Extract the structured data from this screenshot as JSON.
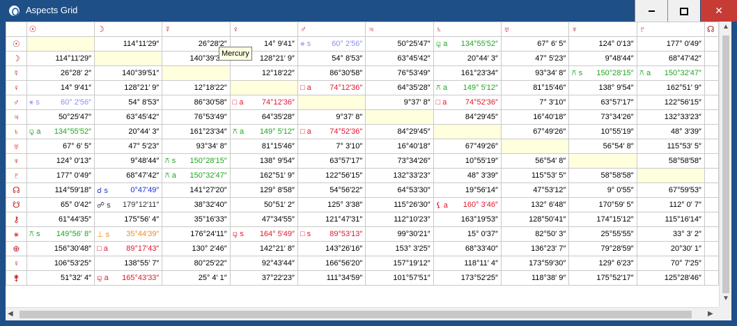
{
  "window": {
    "title": "Aspects Grid",
    "controls": {
      "minimize": "minimize",
      "maximize": "maximize",
      "close": "close",
      "close_glyph": "✕"
    }
  },
  "tooltip": "Mercury",
  "columns": [
    "☉",
    "☽",
    "☿",
    "♀",
    "♂",
    "♃",
    "♄",
    "♅",
    "♆",
    "♇",
    "☊"
  ],
  "rows": [
    {
      "glyph": "☉",
      "cells": [
        {
          "diag": true
        },
        {
          "v": "114°11′29″"
        },
        {
          "v": "26°28′2″"
        },
        {
          "v": "14° 9′41″"
        },
        {
          "a": "⚹ s",
          "c": "#8b8ef0",
          "v": "60° 2′56″"
        },
        {
          "v": "50°25′47″"
        },
        {
          "a": "⚼ a",
          "c": "#1ea51e",
          "v": "134°55′52″"
        },
        {
          "v": "67° 6′ 5″"
        },
        {
          "v": "124° 0′13″"
        },
        {
          "v": "177° 0′49″"
        },
        {
          "v": ""
        }
      ]
    },
    {
      "glyph": "☽",
      "cells": [
        {
          "v": "114°11′29″"
        },
        {
          "diag": true
        },
        {
          "v": "140°39′31″"
        },
        {
          "v": "128°21′ 9″"
        },
        {
          "v": "54° 8′53″"
        },
        {
          "v": "63°45′42″"
        },
        {
          "v": "20°44′ 3″"
        },
        {
          "v": "47° 5′23″"
        },
        {
          "v": "9°48′44″"
        },
        {
          "v": "68°47′42″"
        },
        {
          "v": ""
        }
      ]
    },
    {
      "glyph": "☿",
      "cells": [
        {
          "v": "26°28′ 2″"
        },
        {
          "v": "140°39′51″"
        },
        {
          "diag": true
        },
        {
          "v": "12°18′22″"
        },
        {
          "v": "86°30′58″"
        },
        {
          "v": "76°53′49″"
        },
        {
          "v": "161°23′34″"
        },
        {
          "v": "93°34′ 8″"
        },
        {
          "a": "⚻ s",
          "c": "#1ea51e",
          "v": "150°28′15″"
        },
        {
          "a": "⚻ a",
          "c": "#1ea51e",
          "v": "150°32′47″"
        },
        {
          "v": ""
        }
      ]
    },
    {
      "glyph": "♀",
      "cells": [
        {
          "v": "14° 9′41″"
        },
        {
          "v": "128°21′ 9″"
        },
        {
          "v": "12°18′22″"
        },
        {
          "diag": true
        },
        {
          "a": "□ a",
          "c": "#e0162b",
          "v": "74°12′36″"
        },
        {
          "v": "64°35′28″"
        },
        {
          "a": "⚻ a",
          "c": "#1ea51e",
          "v": "149° 5′12″"
        },
        {
          "v": "81°15′46″"
        },
        {
          "v": "138° 9′54″"
        },
        {
          "v": "162°51′ 9″"
        },
        {
          "v": ""
        }
      ]
    },
    {
      "glyph": "♂",
      "cells": [
        {
          "a": "⚹ s",
          "c": "#8b8ef0",
          "v": "60° 2′56″"
        },
        {
          "v": "54° 8′53″"
        },
        {
          "v": "86°30′58″"
        },
        {
          "a": "□ a",
          "c": "#e0162b",
          "v": "74°12′36″"
        },
        {
          "diag": true
        },
        {
          "v": "9°37′ 8″"
        },
        {
          "a": "□ a",
          "c": "#e0162b",
          "v": "74°52′36″"
        },
        {
          "v": "7° 3′10″"
        },
        {
          "v": "63°57′17″"
        },
        {
          "v": "122°56′15″"
        },
        {
          "v": ""
        }
      ]
    },
    {
      "glyph": "♃",
      "cells": [
        {
          "v": "50°25′47″"
        },
        {
          "v": "63°45′42″"
        },
        {
          "v": "76°53′49″"
        },
        {
          "v": "64°35′28″"
        },
        {
          "v": "9°37′ 8″"
        },
        {
          "diag": true
        },
        {
          "v": "84°29′45″"
        },
        {
          "v": "16°40′18″"
        },
        {
          "v": "73°34′26″"
        },
        {
          "v": "132°33′23″"
        },
        {
          "v": ""
        }
      ]
    },
    {
      "glyph": "♄",
      "cells": [
        {
          "a": "⚼ a",
          "c": "#1ea51e",
          "v": "134°55′52″"
        },
        {
          "v": "20°44′ 3″"
        },
        {
          "v": "161°23′34″"
        },
        {
          "a": "⚻ a",
          "c": "#1ea51e",
          "v": "149° 5′12″"
        },
        {
          "a": "□ a",
          "c": "#e0162b",
          "v": "74°52′36″"
        },
        {
          "v": "84°29′45″"
        },
        {
          "diag": true
        },
        {
          "v": "67°49′26″"
        },
        {
          "v": "10°55′19″"
        },
        {
          "v": "48° 3′39″"
        },
        {
          "v": ""
        }
      ]
    },
    {
      "glyph": "♅",
      "cells": [
        {
          "v": "67° 6′ 5″"
        },
        {
          "v": "47° 5′23″"
        },
        {
          "v": "93°34′ 8″"
        },
        {
          "v": "81°15′46″"
        },
        {
          "v": "7° 3′10″"
        },
        {
          "v": "16°40′18″"
        },
        {
          "v": "67°49′26″"
        },
        {
          "diag": true
        },
        {
          "v": "56°54′ 8″"
        },
        {
          "v": "115°53′ 5″"
        },
        {
          "v": ""
        }
      ]
    },
    {
      "glyph": "♆",
      "cells": [
        {
          "v": "124° 0′13″"
        },
        {
          "v": "9°48′44″"
        },
        {
          "a": "⚻ s",
          "c": "#1ea51e",
          "v": "150°28′15″"
        },
        {
          "v": "138° 9′54″"
        },
        {
          "v": "63°57′17″"
        },
        {
          "v": "73°34′26″"
        },
        {
          "v": "10°55′19″"
        },
        {
          "v": "56°54′ 8″"
        },
        {
          "diag": true
        },
        {
          "v": "58°58′58″"
        },
        {
          "v": ""
        }
      ]
    },
    {
      "glyph": "♇",
      "cells": [
        {
          "v": "177° 0′49″"
        },
        {
          "v": "68°47′42″"
        },
        {
          "a": "⚻ a",
          "c": "#1ea51e",
          "v": "150°32′47″"
        },
        {
          "v": "162°51′ 9″"
        },
        {
          "v": "122°56′15″"
        },
        {
          "v": "132°33′23″"
        },
        {
          "v": "48° 3′39″"
        },
        {
          "v": "115°53′ 5″"
        },
        {
          "v": "58°58′58″"
        },
        {
          "diag": true
        },
        {
          "v": ""
        }
      ]
    },
    {
      "glyph": "☊",
      "cells": [
        {
          "v": "114°59′18″"
        },
        {
          "a": "☌ s",
          "c": "#1730e0",
          "v": "0°47′49″"
        },
        {
          "v": "141°27′20″"
        },
        {
          "v": "129° 8′58″"
        },
        {
          "v": "54°56′22″"
        },
        {
          "v": "64°53′30″"
        },
        {
          "v": "19°56′14″"
        },
        {
          "v": "47°53′12″"
        },
        {
          "v": "9° 0′55″"
        },
        {
          "v": "67°59′53″"
        },
        {
          "v": ""
        }
      ]
    },
    {
      "glyph": "☋",
      "cells": [
        {
          "v": "65° 0′42″"
        },
        {
          "a": "☍ s",
          "c": "#333333",
          "v": "179°12′11″"
        },
        {
          "v": "38°32′40″"
        },
        {
          "v": "50°51′ 2″"
        },
        {
          "v": "125° 3′38″"
        },
        {
          "v": "115°26′30″"
        },
        {
          "a": "⚸ a",
          "c": "#e0162b",
          "v": "160° 3′46″"
        },
        {
          "v": "132° 6′48″"
        },
        {
          "v": "170°59′ 5″"
        },
        {
          "v": "112° 0′ 7″"
        },
        {
          "v": ""
        }
      ]
    },
    {
      "glyph": "⚷",
      "cells": [
        {
          "v": "61°44′35″"
        },
        {
          "v": "175°56′ 4″"
        },
        {
          "v": "35°16′33″"
        },
        {
          "v": "47°34′55″"
        },
        {
          "v": "121°47′31″"
        },
        {
          "v": "112°10′23″"
        },
        {
          "v": "163°19′53″"
        },
        {
          "v": "128°50′41″"
        },
        {
          "v": "174°15′12″"
        },
        {
          "v": "115°16′14″"
        },
        {
          "v": ""
        }
      ]
    },
    {
      "glyph": "⚹",
      "cells": [
        {
          "a": "⚻ s",
          "c": "#1ea51e",
          "v": "149°56′ 8″"
        },
        {
          "a": "⊥ s",
          "c": "#f08a1e",
          "v": "35°44′39″"
        },
        {
          "v": "176°24′11″"
        },
        {
          "a": "⚼ s",
          "c": "#e0162b",
          "v": "164° 5′49″"
        },
        {
          "a": "□ s",
          "c": "#e0162b",
          "v": "89°53′13″"
        },
        {
          "v": "99°30′21″"
        },
        {
          "v": "15° 0′37″"
        },
        {
          "v": "82°50′ 3″"
        },
        {
          "v": "25°55′55″"
        },
        {
          "v": "33° 3′ 2″"
        },
        {
          "v": ""
        }
      ]
    },
    {
      "glyph": "⊕",
      "cells": [
        {
          "v": "156°30′48″"
        },
        {
          "a": "□ a",
          "c": "#e0162b",
          "v": "89°17′43″"
        },
        {
          "v": "130° 2′46″"
        },
        {
          "v": "142°21′ 8″"
        },
        {
          "v": "143°26′16″"
        },
        {
          "v": "153° 3′25″"
        },
        {
          "v": "68°33′40″"
        },
        {
          "v": "136°23′ 7″"
        },
        {
          "v": "79°28′59″"
        },
        {
          "v": "20°30′ 1″"
        },
        {
          "v": ""
        }
      ]
    },
    {
      "glyph": "♀",
      "cells": [
        {
          "v": "106°53′25″"
        },
        {
          "v": "138°55′ 7″"
        },
        {
          "v": "80°25′22″"
        },
        {
          "v": "92°43′44″"
        },
        {
          "v": "166°56′20″"
        },
        {
          "v": "157°19′12″"
        },
        {
          "v": "118°11′ 4″"
        },
        {
          "v": "173°59′30″"
        },
        {
          "v": "129° 6′23″"
        },
        {
          "v": "70° 7′25″"
        },
        {
          "v": ""
        }
      ]
    },
    {
      "glyph": "⚵",
      "cells": [
        {
          "v": "51°32′ 4″"
        },
        {
          "a": "⚼ a",
          "c": "#e0162b",
          "v": "165°43′33″"
        },
        {
          "v": "25° 4′ 1″"
        },
        {
          "v": "37°22′23″"
        },
        {
          "v": "111°34′59″"
        },
        {
          "v": "101°57′51″"
        },
        {
          "v": "173°52′25″"
        },
        {
          "v": "118°38′ 9″"
        },
        {
          "v": "175°52′17″"
        },
        {
          "v": "125°28′46″"
        },
        {
          "v": ""
        }
      ]
    }
  ]
}
